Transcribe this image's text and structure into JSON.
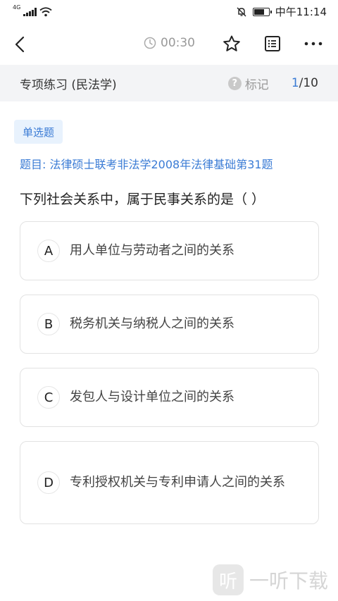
{
  "status_bar": {
    "network": "4G",
    "time": "中午11:14"
  },
  "nav": {
    "timer": "00:30"
  },
  "sub_header": {
    "title": "专项练习 (民法学)",
    "mark_icon": "?",
    "mark_label": "标记",
    "progress_current": "1",
    "progress_total": "/10"
  },
  "question": {
    "type": "单选题",
    "source": "题目: 法律硕士联考非法学2008年法律基础第31题",
    "text": "下列社会关系中，属于民事关系的是（  ）",
    "options": [
      {
        "letter": "A",
        "text": "用人单位与劳动者之间的关系"
      },
      {
        "letter": "B",
        "text": "税务机关与纳税人之间的关系"
      },
      {
        "letter": "C",
        "text": "发包人与设计单位之间的关系"
      },
      {
        "letter": "D",
        "text": "专利授权机关与专利申请人之间的关系"
      }
    ]
  },
  "watermark": {
    "logo": "听",
    "text": "一听下载"
  },
  "colors": {
    "accent": "#3a7bd5",
    "badge_bg": "#e8f2fd",
    "sub_header_bg": "#f3f4f6"
  }
}
